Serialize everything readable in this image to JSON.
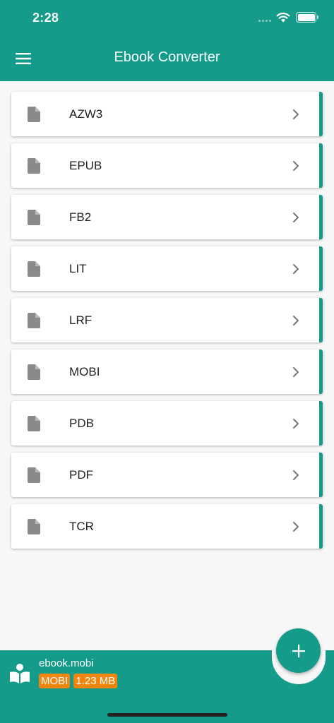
{
  "status_bar": {
    "time": "2:28"
  },
  "header": {
    "title": "Ebook Converter",
    "menu_icon": "hamburger-menu-icon"
  },
  "colors": {
    "primary": "#149b8a",
    "badge": "#f0860e",
    "icon_gray": "#8a8a8a",
    "background": "#f7f7f7"
  },
  "formats": [
    {
      "label": "AZW3",
      "icon": "file-icon"
    },
    {
      "label": "EPUB",
      "icon": "file-icon"
    },
    {
      "label": "FB2",
      "icon": "file-icon"
    },
    {
      "label": "LIT",
      "icon": "file-icon"
    },
    {
      "label": "LRF",
      "icon": "file-icon"
    },
    {
      "label": "MOBI",
      "icon": "file-icon"
    },
    {
      "label": "PDB",
      "icon": "file-icon"
    },
    {
      "label": "PDF",
      "icon": "file-icon"
    },
    {
      "label": "TCR",
      "icon": "file-icon"
    }
  ],
  "fab": {
    "icon": "plus-icon"
  },
  "current_file": {
    "name": "ebook.mobi",
    "format": "MOBI",
    "size": "1.23 MB",
    "icon": "book-reader-icon"
  }
}
